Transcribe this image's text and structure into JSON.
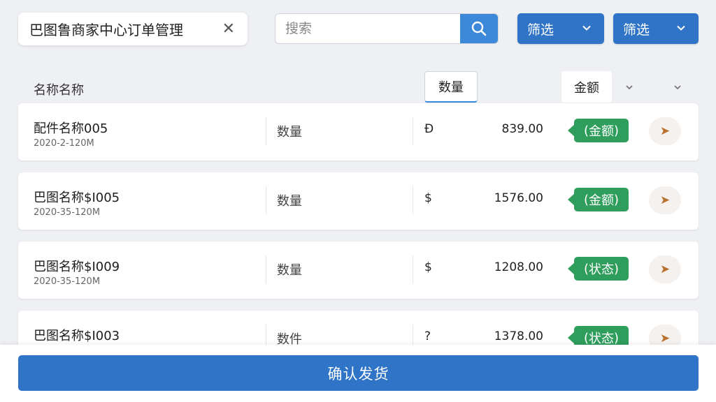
{
  "header": {
    "title": "巴图鲁商家中心订单管理",
    "search_placeholder": "搜索",
    "filter1_label": "筛选",
    "filter2_label": "筛选"
  },
  "columns": {
    "name": "名称名称",
    "quantity": "数量",
    "amount": "金额"
  },
  "orders": [
    {
      "name": "配件名称005",
      "date": "2020-2-120M",
      "qty": "数量",
      "currency": "Đ",
      "amount": "839.00",
      "tag": "金额"
    },
    {
      "name": "巴图名称$I005",
      "date": "2020-35-120M",
      "qty": "数量",
      "currency": "$",
      "amount": "1576.00",
      "tag": "金额"
    },
    {
      "name": "巴图名称$I009",
      "date": "2020-35-120M",
      "qty": "数量",
      "currency": "$",
      "amount": "1208.00",
      "tag": "状态"
    },
    {
      "name": "巴图名称$I003",
      "date": "",
      "qty": "数件",
      "currency": "?",
      "amount": "1378.00",
      "tag": "状态"
    }
  ],
  "footer": {
    "confirm_label": "确认发货"
  },
  "colors": {
    "primary": "#2f74c6",
    "search_button": "#3d89d9",
    "tag": "#2f9d5c",
    "action": "#b8722e"
  },
  "icons": {
    "close": "close-icon",
    "search": "search-icon",
    "chevron": "chevron-down-icon",
    "action": "arrow-right-icon"
  }
}
